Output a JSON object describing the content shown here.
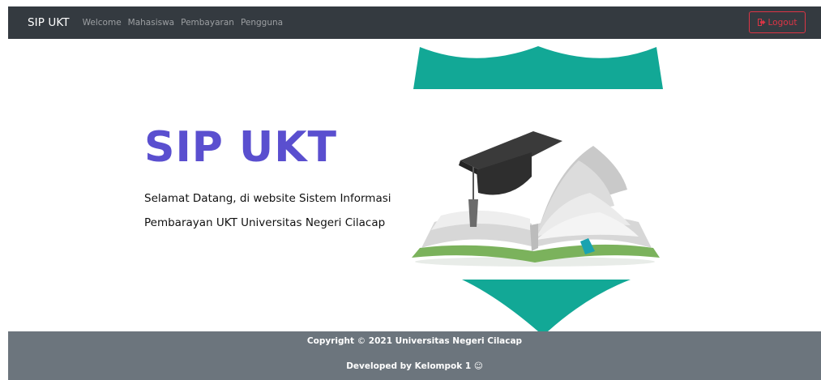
{
  "navbar": {
    "brand": "SIP UKT",
    "links": [
      "Welcome",
      "Mahasiswa",
      "Pembayaran",
      "Pengguna"
    ],
    "logout_label": "Logout"
  },
  "hero": {
    "title": "SIP UKT",
    "line1": "Selamat Datang, di website Sistem Informasi",
    "line2": "Pembarayan UKT Universitas Negeri Cilacap"
  },
  "footer": {
    "copyright_prefix": "Copyright",
    "copyright_symbol": "©",
    "copyright_text": "2021 Universitas Negeri Cilacap",
    "developed_text": "Developed by Kelompok 1",
    "developed_icon": "☺"
  },
  "colors": {
    "navbar_bg": "#343a40",
    "brand_title": "#5a4fcf",
    "logout": "#dc3545",
    "footer_bg": "#6c757d",
    "teal": "#12a896"
  }
}
